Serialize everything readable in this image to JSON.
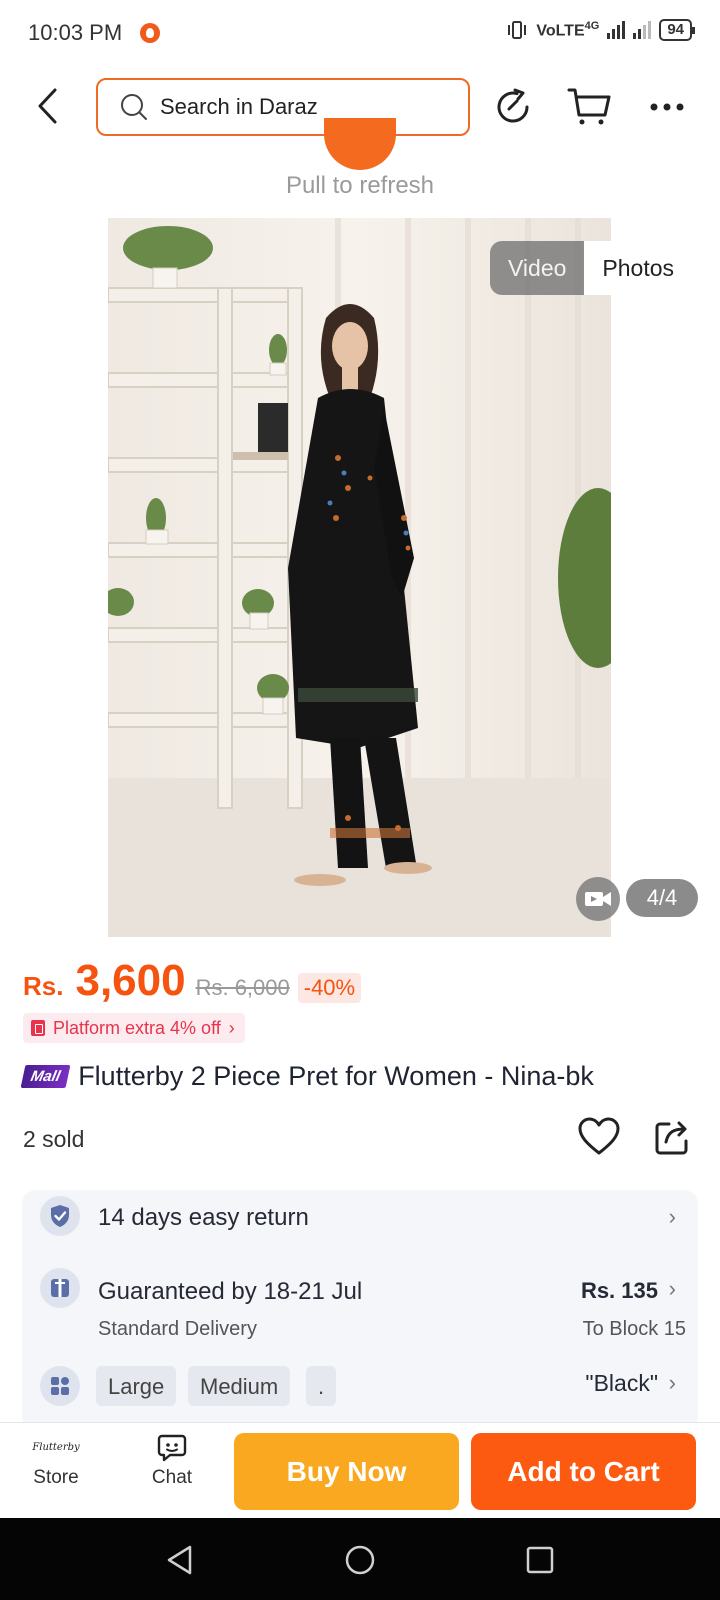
{
  "status_bar": {
    "time": "10:03 PM",
    "network": "VoLTE",
    "network_gen": "4G",
    "battery": "94"
  },
  "header": {
    "search_placeholder": "Search in Daraz",
    "icons": [
      "back-icon",
      "search-icon",
      "refresh-icon",
      "cart-icon",
      "more-icon"
    ]
  },
  "refresh": {
    "label": "Pull to refresh"
  },
  "gallery": {
    "tab_video": "Video",
    "tab_photos": "Photos",
    "active_tab": "Photos",
    "counter": "4/4"
  },
  "price": {
    "currency": "Rs.",
    "current": "3,600",
    "original": "Rs. 6,000",
    "discount": "-40%",
    "promo": "Platform extra 4% off"
  },
  "product": {
    "badge": "Mall",
    "title": "Flutterby 2 Piece Pret for Women - Nina-bk",
    "sold": "2 sold"
  },
  "services": {
    "return": "14 days easy return",
    "delivery_main": "Guaranteed by 18-21 Jul",
    "delivery_sub": "Standard Delivery",
    "delivery_price": "Rs. 135",
    "delivery_to": "To Block 15",
    "variant_chips": [
      "Large",
      "Medium",
      "."
    ],
    "variant_color": "\"Black\""
  },
  "bottom_bar": {
    "store_logo": "Flutterby",
    "store_label": "Store",
    "chat_label": "Chat",
    "buy_now": "Buy Now",
    "add_to_cart": "Add to Cart"
  },
  "colors": {
    "accent": "#f5530f",
    "buy_now": "#faa81f",
    "add_to_cart": "#fb5a10",
    "search_border": "#f06b22"
  }
}
